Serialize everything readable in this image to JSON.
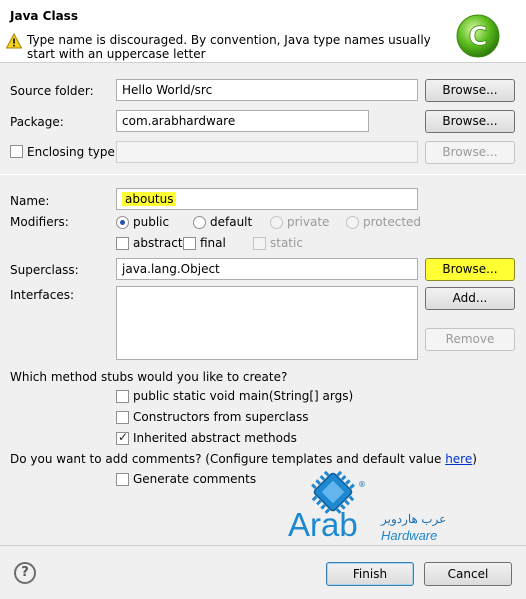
{
  "header": {
    "title": "Java Class",
    "warning": "Type name is discouraged. By convention, Java type names usually start with an uppercase letter"
  },
  "form": {
    "source_folder": {
      "label": "Source folder:",
      "value": "Hello World/src",
      "button": "Browse..."
    },
    "package": {
      "label": "Package:",
      "value": "com.arabhardware",
      "button": "Browse..."
    },
    "enclosing": {
      "label": "Enclosing type:",
      "value": "",
      "button": "Browse..."
    },
    "name": {
      "label": "Name:",
      "value": "aboutus"
    },
    "modifiers": {
      "label": "Modifiers:",
      "public": "public",
      "default": "default",
      "private": "private",
      "protected": "protected",
      "abstract": "abstract",
      "final": "final",
      "static": "static"
    },
    "superclass": {
      "label": "Superclass:",
      "value": "java.lang.Object",
      "button": "Browse..."
    },
    "interfaces": {
      "label": "Interfaces:",
      "add": "Add...",
      "remove": "Remove"
    },
    "stubs": {
      "question": "Which method stubs would you like to create?",
      "main": "public static void main(String[] args)",
      "constructors": "Constructors from superclass",
      "inherited": "Inherited abstract methods"
    },
    "comments": {
      "question_prefix": "Do you want to add comments? (Configure templates and default value ",
      "link": "here",
      "question_suffix": ")",
      "generate": "Generate comments"
    }
  },
  "watermark": {
    "arab": "Arab",
    "hardware": "Hardware",
    "arabic": "عرب هاردوير",
    "reg": "®"
  },
  "footer": {
    "help": "?",
    "finish": "Finish",
    "cancel": "Cancel"
  },
  "colors": {
    "highlight": "#ffff33",
    "link": "#0033cc",
    "logo_green": "#5fbf1f"
  }
}
